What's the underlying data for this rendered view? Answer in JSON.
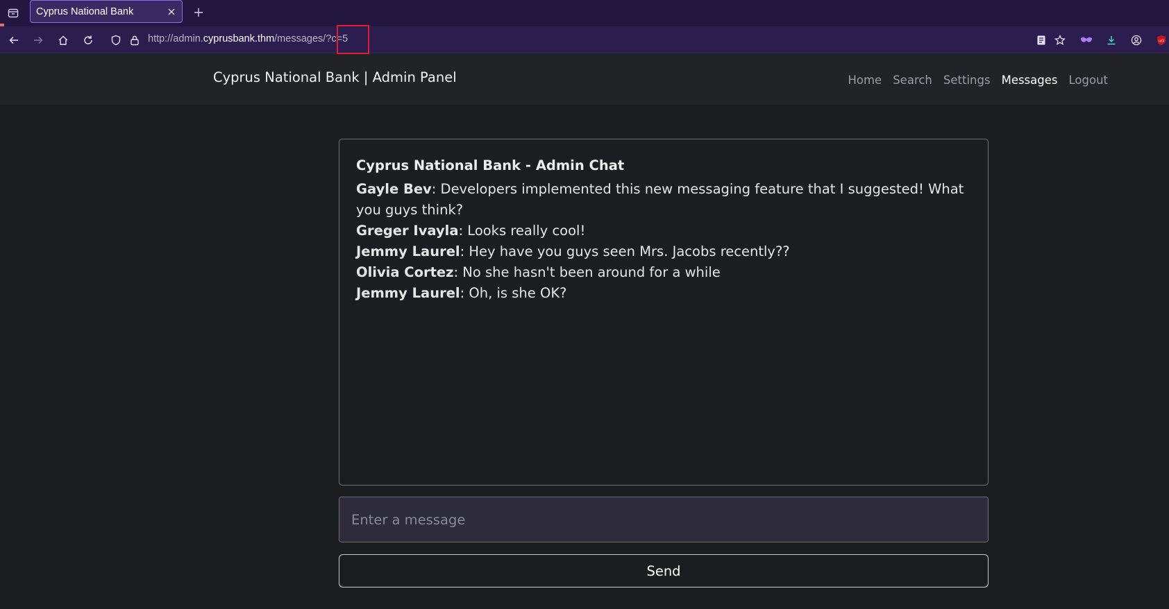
{
  "browser": {
    "tab_title": "Cyprus National Bank",
    "url_prefix": "http://admin.",
    "url_host": "cyprusbank.thm",
    "url_path": "/messages/",
    "url_query": "?c=5"
  },
  "header": {
    "brand": "Cyprus National Bank | Admin Panel",
    "nav": [
      "Home",
      "Search",
      "Settings",
      "Messages",
      "Logout"
    ],
    "active_nav": "Messages"
  },
  "chat": {
    "title": "Cyprus National Bank - Admin Chat",
    "messages": [
      {
        "author": "Gayle Bev",
        "text": ": Developers implemented this new messaging feature that I suggested! What you guys think?"
      },
      {
        "author": "Greger Ivayla",
        "text": ": Looks really cool!"
      },
      {
        "author": "Jemmy Laurel",
        "text": ": Hey have you guys seen Mrs. Jacobs recently??"
      },
      {
        "author": "Olivia Cortez",
        "text": ": No she hasn't been around for a while"
      },
      {
        "author": "Jemmy Laurel",
        "text": ": Oh, is she OK?"
      }
    ]
  },
  "composer": {
    "placeholder": "Enter a message",
    "value": "",
    "send_label": "Send"
  },
  "colors": {
    "tabbar": "#23173f",
    "navbar": "#2b1e4f",
    "page_bg": "#1c1d21",
    "highlight": "#e01f2d"
  }
}
